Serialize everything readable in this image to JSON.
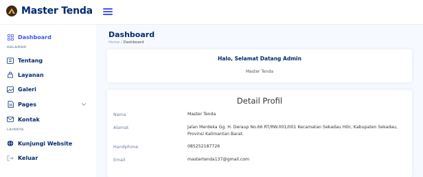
{
  "brand": {
    "name": "Master Tenda"
  },
  "sidebar": {
    "items": [
      {
        "label": "Dashboard"
      },
      {
        "label": "Tentang"
      },
      {
        "label": "Layanan"
      },
      {
        "label": "Galeri"
      },
      {
        "label": "Pages"
      },
      {
        "label": "Kontak"
      },
      {
        "label": "Kunjungi Website"
      },
      {
        "label": "Keluar"
      }
    ],
    "headings": [
      "HALAMAN",
      "LAINNYA"
    ]
  },
  "header": {
    "title": "Dashboard",
    "breadcrumb": [
      "Home",
      "Dashboard"
    ],
    "breadcrumb_sep": "/"
  },
  "welcome": {
    "title": "Halo, Selamat Datang Admin",
    "subtitle": "Master Tenda"
  },
  "profile": {
    "title": "Detail Profil",
    "rows": [
      {
        "label": "Nama",
        "value": "Master Tenda"
      },
      {
        "label": "Alamat",
        "value": "Jalan Merdeka Gg. H. Deraup No.66 RT/RW.001/001 Kecamatan Sekadau Hilir, Kabupaten Sekadau, Provinsi Kalimantan Barat."
      },
      {
        "label": "Handphone",
        "value": "085252187726"
      },
      {
        "label": "Email",
        "value": "mastertenda137@gmail.com"
      }
    ]
  },
  "colors": {
    "accent": "#4154f1",
    "navy": "#012970",
    "muted": "#899bbd",
    "background": "#f6f9ff"
  }
}
